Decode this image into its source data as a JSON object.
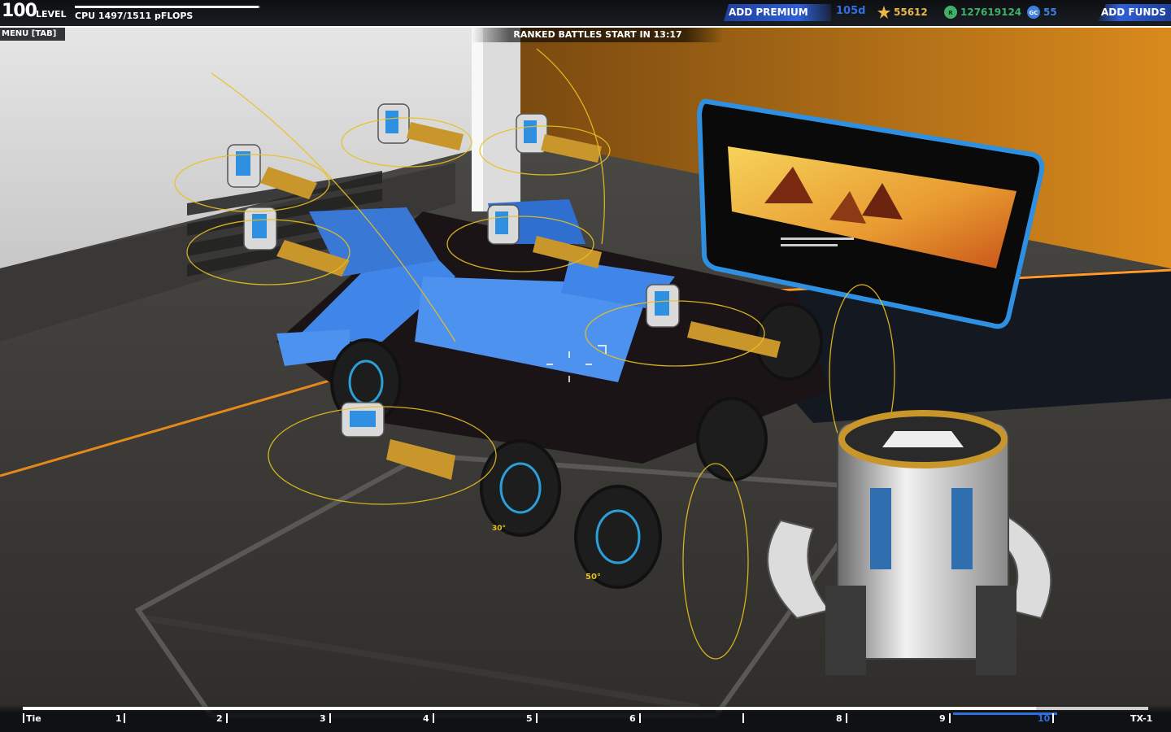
{
  "hud": {
    "level_number": "100",
    "level_label": "LEVEL",
    "cpu_text": "CPU 1497/1511 pFLOPS",
    "cpu_fill_fraction": 0.99,
    "add_premium_label": "ADD PREMIUM",
    "premium_days": "105d",
    "tech_points": "55612",
    "robits": "127619124",
    "galaxy_coins": "55",
    "add_funds_label": "ADD FUNDS",
    "menu_label": "MENU [TAB]",
    "ranked_text": "RANKED BATTLES START IN 13:17",
    "icons": [
      "tech-points-icon",
      "robits-icon",
      "galaxy-coins-icon"
    ],
    "colors": {
      "premium_blue": "#2f6fe0",
      "tech_gold": "#e8b84a",
      "robits_green": "#3fb06a",
      "gc_blue": "#3f7fe0"
    }
  },
  "tier_bar": {
    "labels": [
      "Tie",
      "1",
      "2",
      "3",
      "4",
      "5",
      "6",
      "8",
      "9",
      "10",
      "TX-1"
    ],
    "progress_fraction": 0.9,
    "current_tier": "10"
  }
}
